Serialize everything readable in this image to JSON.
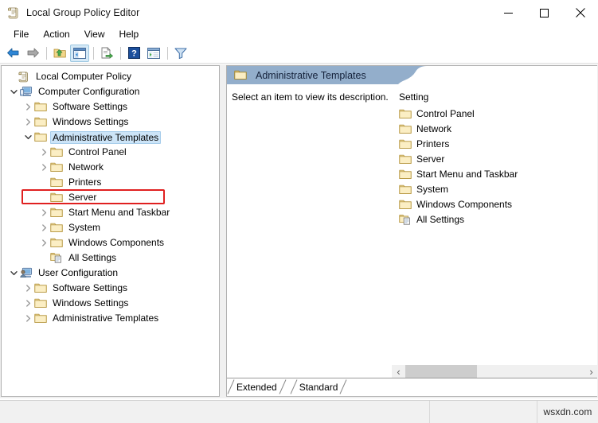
{
  "window": {
    "title": "Local Group Policy Editor",
    "icon": "policy-scroll-icon",
    "minimize_label": "–",
    "maximize_label": "□",
    "close_label": "✕"
  },
  "menubar": {
    "items": [
      {
        "label": "File"
      },
      {
        "label": "Action"
      },
      {
        "label": "View"
      },
      {
        "label": "Help"
      }
    ]
  },
  "toolbar": {
    "buttons": [
      {
        "name": "back-arrow-icon",
        "tooltip": "Back"
      },
      {
        "name": "forward-arrow-icon",
        "tooltip": "Forward"
      },
      {
        "name": "up-folder-icon",
        "tooltip": "Up One Level"
      },
      {
        "name": "show-hide-tree-icon",
        "tooltip": "Show/Hide Console Tree",
        "active": true
      },
      {
        "name": "export-list-icon",
        "tooltip": "Export List"
      },
      {
        "name": "help-icon",
        "tooltip": "Help"
      },
      {
        "name": "properties-icon",
        "tooltip": "Properties"
      },
      {
        "name": "filter-icon",
        "tooltip": "Filter"
      }
    ]
  },
  "tree": {
    "nodes": [
      {
        "label": "Local Computer Policy",
        "indent": 0,
        "chevron": "none",
        "icon": "policy-scroll-icon",
        "selected": false
      },
      {
        "label": "Computer Configuration",
        "indent": 1,
        "chevron": "down",
        "icon": "computer-icon",
        "selected": false
      },
      {
        "label": "Software Settings",
        "indent": 2,
        "chevron": "right",
        "icon": "folder-icon",
        "selected": false
      },
      {
        "label": "Windows Settings",
        "indent": 2,
        "chevron": "right",
        "icon": "folder-icon",
        "selected": false
      },
      {
        "label": "Administrative Templates",
        "indent": 2,
        "chevron": "down",
        "icon": "folder-icon",
        "selected": true
      },
      {
        "label": "Control Panel",
        "indent": 3,
        "chevron": "right",
        "icon": "folder-icon",
        "selected": false
      },
      {
        "label": "Network",
        "indent": 3,
        "chevron": "right",
        "icon": "folder-icon",
        "selected": false
      },
      {
        "label": "Printers",
        "indent": 3,
        "chevron": "none",
        "icon": "folder-icon",
        "selected": false
      },
      {
        "label": "Server",
        "indent": 3,
        "chevron": "none",
        "icon": "folder-icon",
        "selected": false
      },
      {
        "label": "Start Menu and Taskbar",
        "indent": 3,
        "chevron": "right",
        "icon": "folder-icon",
        "selected": false
      },
      {
        "label": "System",
        "indent": 3,
        "chevron": "right",
        "icon": "folder-icon",
        "selected": false
      },
      {
        "label": "Windows Components",
        "indent": 3,
        "chevron": "right",
        "icon": "folder-icon",
        "selected": false
      },
      {
        "label": "All Settings",
        "indent": 3,
        "chevron": "none",
        "icon": "all-settings-icon",
        "selected": false
      },
      {
        "label": "User Configuration",
        "indent": 1,
        "chevron": "down",
        "icon": "user-icon",
        "selected": false
      },
      {
        "label": "Software Settings",
        "indent": 2,
        "chevron": "right",
        "icon": "folder-icon",
        "selected": false
      },
      {
        "label": "Windows Settings",
        "indent": 2,
        "chevron": "right",
        "icon": "folder-icon",
        "selected": false
      },
      {
        "label": "Administrative Templates",
        "indent": 2,
        "chevron": "right",
        "icon": "folder-icon",
        "selected": false
      }
    ],
    "annotation": {
      "color": "#e02020",
      "target": "Administrative Templates"
    }
  },
  "right_panel": {
    "header_title": "Administrative Templates",
    "header_icon": "folder-icon",
    "header_color": "#93aecb",
    "description": "Select an item to view its description.",
    "column_header": "Setting",
    "items": [
      {
        "label": "Control Panel",
        "icon": "folder-icon"
      },
      {
        "label": "Network",
        "icon": "folder-icon"
      },
      {
        "label": "Printers",
        "icon": "folder-icon"
      },
      {
        "label": "Server",
        "icon": "folder-icon"
      },
      {
        "label": "Start Menu and Taskbar",
        "icon": "folder-icon"
      },
      {
        "label": "System",
        "icon": "folder-icon"
      },
      {
        "label": "Windows Components",
        "icon": "folder-icon"
      },
      {
        "label": "All Settings",
        "icon": "all-settings-icon"
      }
    ],
    "scrollbar": {
      "left_arrow": "‹",
      "right_arrow": "›",
      "thumb_percent": 40
    },
    "tabs": [
      {
        "label": "Extended",
        "selected": false
      },
      {
        "label": "Standard",
        "selected": true
      }
    ]
  },
  "statusbar": {
    "watermark": "wsxdn.com"
  }
}
